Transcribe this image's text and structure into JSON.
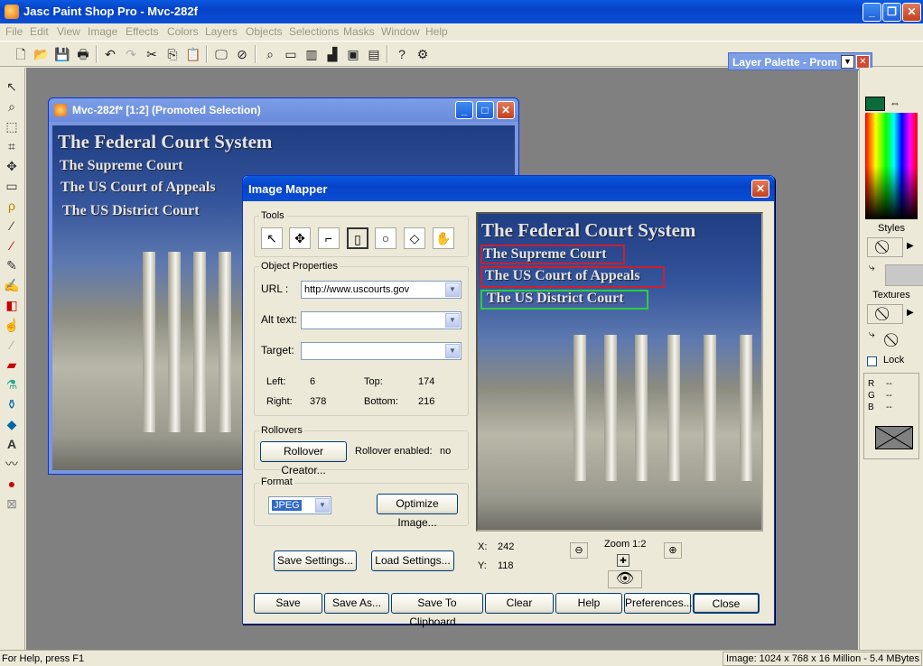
{
  "app": {
    "title": "Jasc Paint Shop Pro - Mvc-282f",
    "menu": [
      "File",
      "Edit",
      "View",
      "Image",
      "Effects",
      "Colors",
      "Layers",
      "Objects",
      "Selections",
      "Masks",
      "Window",
      "Help"
    ],
    "window_buttons": {
      "minimize": "_",
      "restore": "❐",
      "close": "✕"
    }
  },
  "layer_palette": {
    "title": "Layer Palette - Prom"
  },
  "image_window": {
    "title": "Mvc-282f* [1:2] (Promoted Selection)",
    "text_lines": [
      "The Federal Court System",
      "The Supreme Court",
      "The US Court of Appeals",
      "The US District Court"
    ]
  },
  "mapper": {
    "title": "Image Mapper",
    "tools_label": "Tools",
    "tools": [
      "arrow-tool-icon",
      "move-tool-icon",
      "polygon-tool-icon",
      "rectangle-tool-icon",
      "circle-tool-icon",
      "eraser-tool-icon",
      "hand-tool-icon"
    ],
    "object_properties_label": "Object Properties",
    "url_label": "URL :",
    "url_value": "http://www.uscourts.gov",
    "alt_label": "Alt text:",
    "alt_value": "",
    "target_label": "Target:",
    "target_value": "",
    "left_label": "Left:",
    "left_value": "6",
    "top_label": "Top:",
    "top_value": "174",
    "right_label": "Right:",
    "right_value": "378",
    "bottom_label": "Bottom:",
    "bottom_value": "216",
    "rollovers_label": "Rollovers",
    "rollover_creator": "Rollover Creator...",
    "rollover_enabled_label": "Rollover enabled:",
    "rollover_enabled_value": "no",
    "format_label": "Format",
    "format_value": "JPEG",
    "optimize": "Optimize Image...",
    "save_settings": "Save Settings...",
    "load_settings": "Load Settings...",
    "x_label": "X:",
    "x_value": "242",
    "y_label": "Y:",
    "y_value": "118",
    "zoom_label": "Zoom 1:2",
    "buttons": {
      "save": "Save",
      "save_as": "Save As...",
      "clipboard": "Save To Clipboard...",
      "clear": "Clear",
      "help": "Help",
      "preferences": "Preferences...",
      "close": "Close"
    }
  },
  "right_panel": {
    "styles_label": "Styles",
    "textures_label": "Textures",
    "lock_label": "Lock",
    "r_label": "R",
    "g_label": "G",
    "b_label": "B",
    "r_value": "--",
    "g_value": "--",
    "b_value": "--",
    "fg_color": "#0b6b3a"
  },
  "status": {
    "help": "For Help, press F1",
    "image_info": "Image:  1024 x 768 x 16 Million - 5.4 MBytes"
  }
}
